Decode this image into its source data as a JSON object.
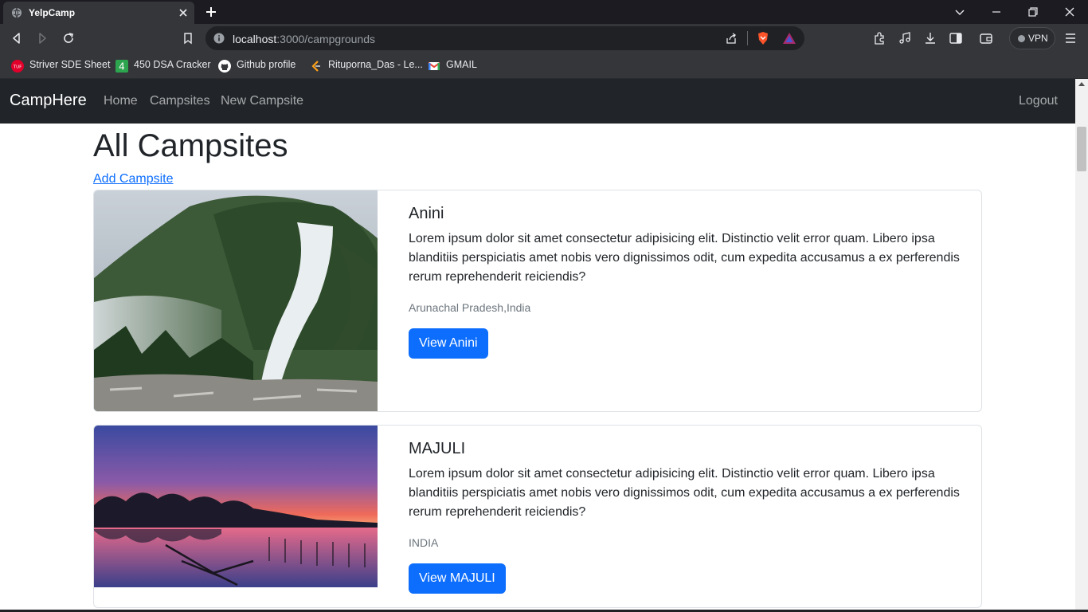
{
  "browser": {
    "tab_title": "YelpCamp",
    "url_host": "localhost",
    "url_path": ":3000/campgrounds",
    "vpn_label": "VPN",
    "bookmarks": [
      {
        "label": "Striver SDE Sheet",
        "icon": "tuf-icon",
        "color": "#e0002a"
      },
      {
        "label": "450 DSA Cracker",
        "icon": "four-badge-icon",
        "color": "#2da44e"
      },
      {
        "label": "Github profile",
        "icon": "github-icon",
        "color": "#ffffff"
      },
      {
        "label": "Rituporna_Das - Le...",
        "icon": "leetcode-icon",
        "color": "#ffa116"
      },
      {
        "label": "GMAIL",
        "icon": "gmail-icon",
        "color": "#ea4335"
      }
    ]
  },
  "navbar": {
    "brand": "CampHere",
    "links": [
      "Home",
      "Campsites",
      "New Campsite"
    ],
    "logout": "Logout"
  },
  "page": {
    "title": "All Campsites",
    "add_link": "Add Campsite"
  },
  "campgrounds": [
    {
      "title": "Anini",
      "description": "Lorem ipsum dolor sit amet consectetur adipisicing elit. Distinctio velit error quam. Libero ipsa blanditiis perspiciatis amet nobis vero dignissimos odit, cum expedita accusamus a ex perferendis rerum reprehenderit reiciendis?",
      "location": "Arunachal Pradesh,India",
      "button": "View Anini",
      "image": "waterfall-forest-image"
    },
    {
      "title": "MAJULI",
      "description": "Lorem ipsum dolor sit amet consectetur adipisicing elit. Distinctio velit error quam. Libero ipsa blanditiis perspiciatis amet nobis vero dignissimos odit, cum expedita accusamus a ex perferendis rerum reprehenderit reiciendis?",
      "location": "INDIA",
      "button": "View MAJULI",
      "image": "sunset-river-image"
    }
  ],
  "colors": {
    "primary": "#0d6efd",
    "navbar_bg": "#212529",
    "muted": "#6c757d"
  }
}
